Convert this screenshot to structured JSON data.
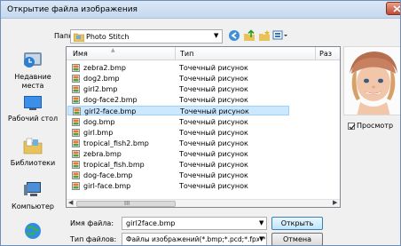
{
  "window": {
    "title": "Открытие файла изображения"
  },
  "folder": {
    "label": "Папка:",
    "value": "Photo Stitch"
  },
  "places": [
    {
      "label": "Недавние места"
    },
    {
      "label": "Рабочий стол"
    },
    {
      "label": "Библиотеки"
    },
    {
      "label": "Компьютер"
    },
    {
      "label": ""
    }
  ],
  "list": {
    "columns": {
      "name": "Имя",
      "type": "Тип",
      "size": "Раз"
    },
    "files": [
      {
        "name": "zebra2.bmp",
        "type": "Точечный рисунок"
      },
      {
        "name": "dog2.bmp",
        "type": "Точечный рисунок"
      },
      {
        "name": "girl2.bmp",
        "type": "Точечный рисунок"
      },
      {
        "name": "dog-face2.bmp",
        "type": "Точечный рисунок"
      },
      {
        "name": "girl2-face.bmp",
        "type": "Точечный рисунок"
      },
      {
        "name": "dog.bmp",
        "type": "Точечный рисунок"
      },
      {
        "name": "girl.bmp",
        "type": "Точечный рисунок"
      },
      {
        "name": "tropical_fish2.bmp",
        "type": "Точечный рисунок"
      },
      {
        "name": "zebra.bmp",
        "type": "Точечный рисунок"
      },
      {
        "name": "tropical_fish.bmp",
        "type": "Точечный рисунок"
      },
      {
        "name": "dog-face.bmp",
        "type": "Точечный рисунок"
      },
      {
        "name": "girl-face.bmp",
        "type": "Точечный рисунок"
      }
    ],
    "selected": "girl2-face.bmp",
    "scroll_grip": "III"
  },
  "preview": {
    "checkbox_label": "Просмотр",
    "checked": true
  },
  "filename": {
    "label": "Имя файла:",
    "value": "girl2face.bmp"
  },
  "filetype": {
    "label": "Тип файлов:",
    "value": "Файлы изображений(*.bmp;*.pcd;*.fpx;*.tif;*.j"
  },
  "buttons": {
    "open": "Открыть",
    "cancel": "Отмена"
  },
  "colors": {
    "selection": "#cce8ff",
    "title_bar": "#c4d8ee",
    "close": "#c24a32"
  }
}
